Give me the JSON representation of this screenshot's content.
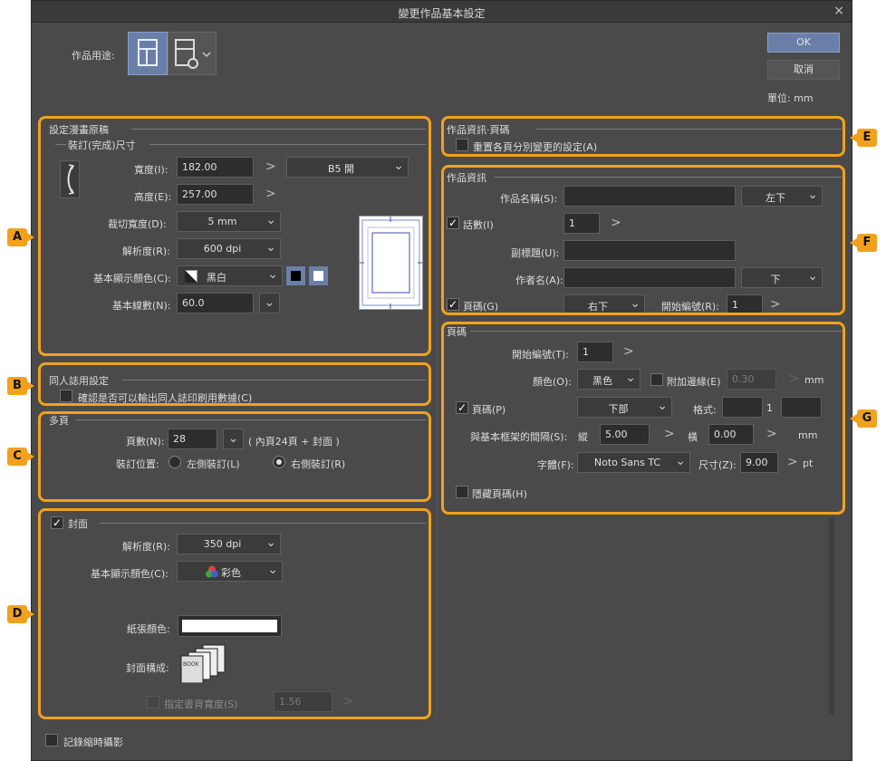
{
  "window": {
    "title": "變更作品基本設定",
    "close": "×"
  },
  "top": {
    "purpose_label": "作品用途:",
    "ok": "OK",
    "cancel": "取消",
    "unit": "單位: mm"
  },
  "markers": {
    "A": "A",
    "B": "B",
    "C": "C",
    "D": "D",
    "E": "E",
    "F": "F",
    "G": "G"
  },
  "manga": {
    "title": "設定漫畫原稿",
    "binding_title": "裝訂(完成)尺寸",
    "width_label": "寬度(I):",
    "width_value": "182.00",
    "height_label": "高度(E):",
    "height_value": "257.00",
    "preset": "B5 開",
    "bleed_label": "裁切寬度(D):",
    "bleed_value": "5 mm",
    "resolution_label": "解析度(R):",
    "resolution_value": "600 dpi",
    "color_label": "基本顯示顏色(C):",
    "color_value": "黑白",
    "lines_label": "基本線數(N):",
    "lines_value": "60.0",
    "arrow": ">"
  },
  "doujin": {
    "title": "同人誌用設定",
    "check_label": "確認是否可以輸出同人誌印刷用數據(C)"
  },
  "pages": {
    "title": "多頁",
    "count_label": "頁數(N):",
    "count_value": "28",
    "count_note": "( 內頁24頁 + 封面 )",
    "binding_label": "裝訂位置:",
    "left_label": "左側裝訂(L)",
    "right_label": "右側裝訂(R)"
  },
  "cover": {
    "title": "封面",
    "resolution_label": "解析度(R):",
    "resolution_value": "350 dpi",
    "color_label": "基本顯示顏色(C):",
    "color_value": "彩色",
    "paper_label": "紙張顏色:",
    "layout_label": "封面構成:",
    "spine_label": "指定書背寬度(S)",
    "spine_value": "1.56",
    "book_text": "BOOK",
    "arrow": ">"
  },
  "timelapse": {
    "label": "記錄縮時攝影"
  },
  "info_pages": {
    "title": "作品資訊‧頁碼",
    "check_label": "重置各頁分別變更的設定(A)"
  },
  "info": {
    "title": "作品資訊",
    "name_label": "作品名稱(S):",
    "name_pos": "左下",
    "episode_label": "話數(I)",
    "episode_value": "1",
    "subtitle_label": "副標題(U):",
    "author_label": "作者名(A):",
    "author_pos": "下",
    "pagenum_label": "頁碼(G)",
    "pagenum_pos": "右下",
    "start_label": "開始編號(R):",
    "start_value": "1",
    "arrow": ">"
  },
  "pagenum": {
    "title": "頁碼",
    "start_label": "開始編號(T):",
    "start_value": "1",
    "color_label": "顏色(O):",
    "color_value": "黑色",
    "border_label": "附加邊緣(E)",
    "border_value": "0.30",
    "border_unit": "mm",
    "page_label": "頁碼(P)",
    "page_pos": "下部",
    "format_label": "格式:",
    "format_mid": "1",
    "gap_label": "與基本框架的間隔(S):",
    "vert_label": "縱",
    "vert_value": "5.00",
    "horiz_label": "橫",
    "horiz_value": "0.00",
    "gap_unit": "mm",
    "font_label": "字體(F):",
    "font_value": "Noto Sans TC",
    "size_label": "尺寸(Z):",
    "size_value": "9.00",
    "size_unit": "pt",
    "hide_label": "隱藏頁碼(H)",
    "arrow": ">"
  },
  "colors": {
    "highlight": "#f2a11e",
    "accent": "#6a7fa8",
    "panel": "#4a4a4a"
  }
}
